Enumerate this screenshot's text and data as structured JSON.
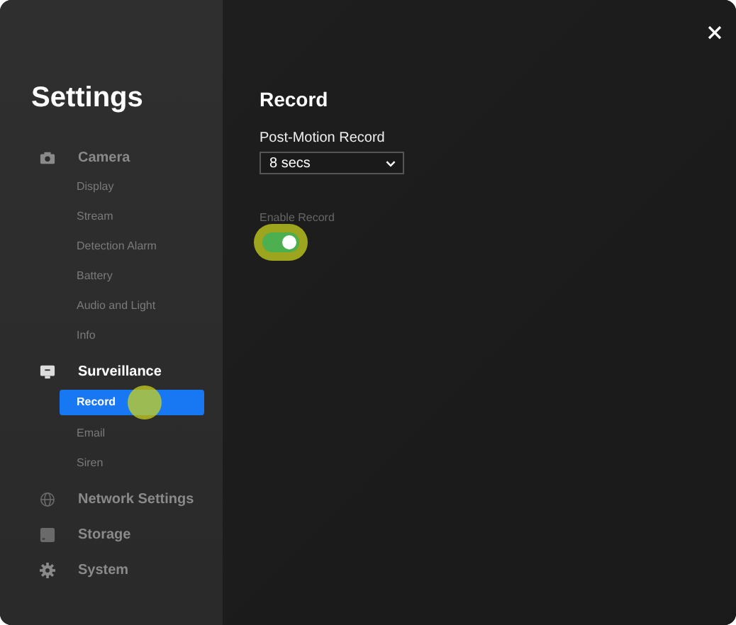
{
  "title": "Settings",
  "nav": [
    {
      "label": "Camera",
      "kind": "camera",
      "children": [
        {
          "label": "Display",
          "selected": false
        },
        {
          "label": "Stream",
          "selected": false
        },
        {
          "label": "Detection Alarm",
          "selected": false
        },
        {
          "label": "Battery",
          "selected": false
        },
        {
          "label": "Audio and Light",
          "selected": false
        },
        {
          "label": "Info",
          "selected": false
        }
      ]
    },
    {
      "label": "Surveillance",
      "kind": "monitor",
      "children": [
        {
          "label": "Record",
          "selected": true
        },
        {
          "label": "Email",
          "selected": false
        },
        {
          "label": "Siren",
          "selected": false
        }
      ]
    },
    {
      "label": "Network Settings",
      "kind": "globe"
    },
    {
      "label": "Storage",
      "kind": "drive"
    },
    {
      "label": "System",
      "kind": "gear"
    }
  ],
  "heading": "Record",
  "fields": [
    {
      "kind": "select",
      "label": "Post-Motion Record",
      "value": "8 secs"
    },
    {
      "kind": "toggle",
      "label": "Enable Record",
      "on": true
    }
  ]
}
